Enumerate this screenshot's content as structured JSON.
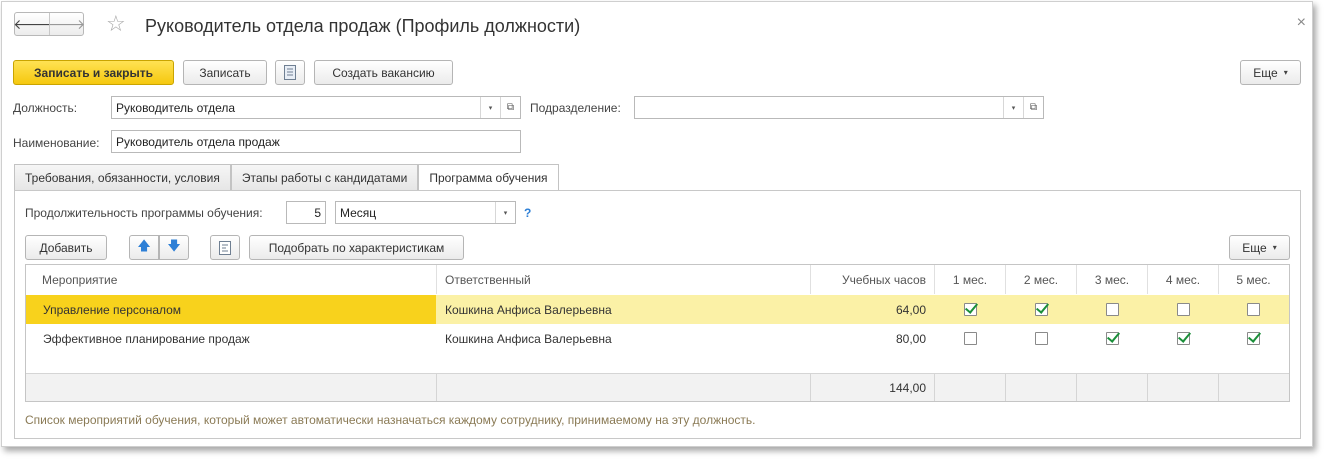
{
  "window": {
    "title": "Руководитель отдела продаж (Профиль должности)",
    "close_glyph": "×"
  },
  "nav": {
    "back_glyph": "🡐",
    "forward_glyph": "🡒",
    "star_glyph": "☆"
  },
  "toolbar": {
    "save_close_label": "Записать и закрыть",
    "save_label": "Записать",
    "create_vacancy_label": "Создать вакансию",
    "more_label": "Еще",
    "caret": "▾"
  },
  "form": {
    "position_label": "Должность:",
    "position_value": "Руководитель отдела",
    "department_label": "Подразделение:",
    "department_value": "",
    "name_label": "Наименование:",
    "name_value": "Руководитель отдела продаж",
    "dd_glyph": "▾",
    "open_glyph": "⧉"
  },
  "tabs": [
    {
      "label": "Требования, обязанности, условия"
    },
    {
      "label": "Этапы работы с кандидатами"
    },
    {
      "label": "Программа обучения"
    }
  ],
  "training": {
    "duration_label": "Продолжительность программы обучения:",
    "duration_value": "5",
    "unit_value": "Месяц",
    "help_glyph": "?",
    "add_label": "Добавить",
    "up_glyph": "🡅",
    "down_glyph": "🡇",
    "pick_label": "Подобрать по характеристикам",
    "more_label": "Еще",
    "note": "Список мероприятий обучения, который может автоматически назначаться каждому сотруднику, принимаемому на эту должность."
  },
  "table": {
    "headers": [
      "Мероприятие",
      "Ответственный",
      "Учебных часов",
      "1 мес.",
      "2 мес.",
      "3 мес.",
      "4 мес.",
      "5 мес."
    ],
    "rows": [
      {
        "event": "Управление персоналом",
        "responsible": "Кошкина Анфиса Валерьевна",
        "hours": "64,00",
        "months": [
          true,
          true,
          false,
          false,
          false
        ]
      },
      {
        "event": "Эффективное планирование продаж",
        "responsible": "Кошкина Анфиса Валерьевна",
        "hours": "80,00",
        "months": [
          false,
          false,
          true,
          true,
          true
        ]
      }
    ],
    "total_hours": "144,00"
  },
  "colors": {
    "accent_yellow": "#f5c80f",
    "selected_row": "#fbf1a6",
    "check_green": "#1b8f3a",
    "link_blue": "#2d7fd6"
  }
}
